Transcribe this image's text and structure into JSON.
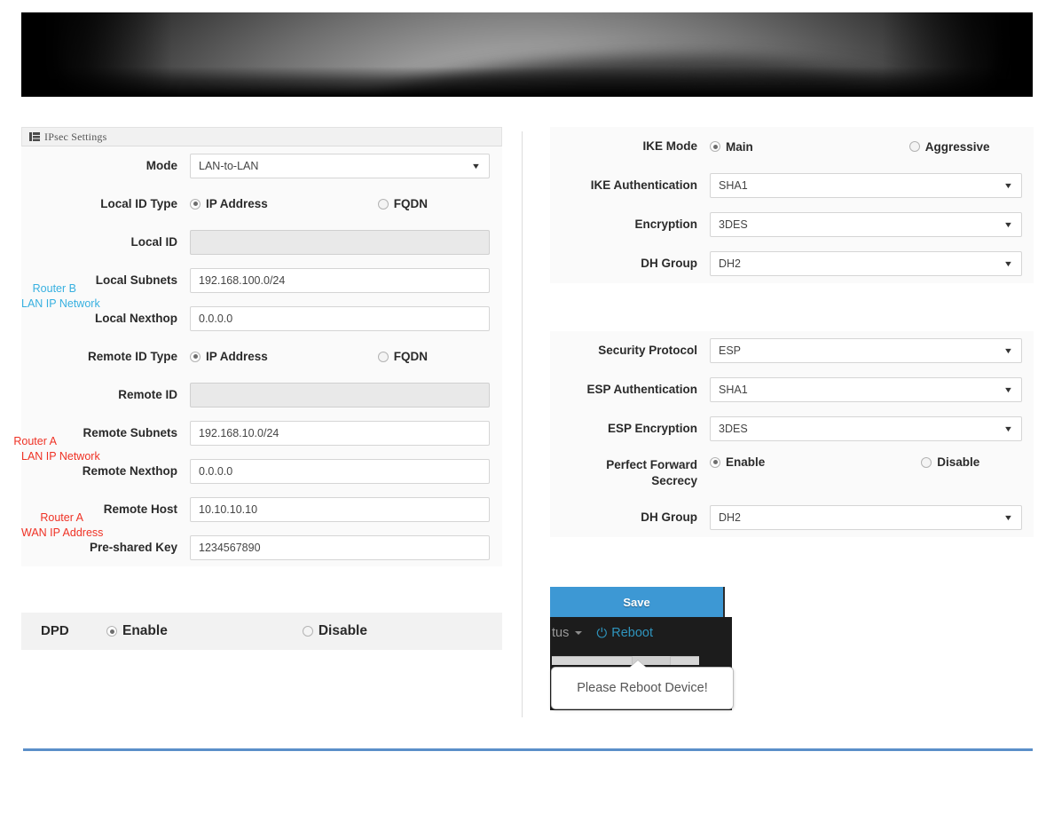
{
  "card": {
    "title": "IPsec Settings",
    "icon": "grid-list-icon"
  },
  "left": {
    "mode": {
      "label": "Mode",
      "value": "LAN-to-LAN"
    },
    "local_id_type": {
      "label": "Local ID Type",
      "options": [
        "IP Address",
        "FQDN"
      ],
      "selected": "IP Address"
    },
    "local_id": {
      "label": "Local ID",
      "value": "",
      "disabled": true
    },
    "local_subnets": {
      "label": "Local Subnets",
      "note_line1": "Router B",
      "note_line2": "LAN IP Network",
      "note_color": "#37b0e0",
      "value": "192.168.100.0/24"
    },
    "local_nexthop": {
      "label": "Local Nexthop",
      "value": "0.0.0.0"
    },
    "remote_id_type": {
      "label": "Remote ID Type",
      "options": [
        "IP Address",
        "FQDN"
      ],
      "selected": "IP Address"
    },
    "remote_id": {
      "label": "Remote ID",
      "value": "",
      "disabled": true
    },
    "remote_subnets": {
      "label": "Remote Subnets",
      "note_line1": "Router A",
      "note_line2": "LAN IP Network",
      "note_color": "#ef3124",
      "value": "192.168.10.0/24"
    },
    "remote_nexthop": {
      "label": "Remote Nexthop",
      "value": "0.0.0.0"
    },
    "remote_host": {
      "label": "Remote Host",
      "note_line1": "Router A",
      "note_line2": "WAN IP Address",
      "note_color": "#ef3124",
      "value": "10.10.10.10"
    },
    "psk": {
      "label": "Pre-shared Key",
      "value": "1234567890"
    },
    "dpd": {
      "label": "DPD",
      "options": [
        "Enable",
        "Disable"
      ],
      "selected": "Enable"
    }
  },
  "right": {
    "ike_mode": {
      "label": "IKE Mode",
      "options": [
        "Main",
        "Aggressive"
      ],
      "selected": "Main"
    },
    "ike_auth": {
      "label": "IKE Authentication",
      "value": "SHA1"
    },
    "encryption": {
      "label": "Encryption",
      "value": "3DES"
    },
    "dh_group_1": {
      "label": "DH Group",
      "value": "DH2"
    },
    "security_protocol": {
      "label": "Security Protocol",
      "value": "ESP"
    },
    "esp_auth": {
      "label": "ESP Authentication",
      "value": "SHA1"
    },
    "esp_encryption": {
      "label": "ESP Encryption",
      "value": "3DES"
    },
    "pfs": {
      "label_line1": "Perfect Forward",
      "label_line2": "Secrecy",
      "options": [
        "Enable",
        "Disable"
      ],
      "selected": "Enable"
    },
    "dh_group_2": {
      "label": "DH Group",
      "value": "DH2"
    }
  },
  "actions": {
    "save_label": "Save",
    "save_color": "#3d98d4"
  },
  "navbar": {
    "status_label": "tus",
    "reboot_label": "Reboot",
    "power_icon": "power-icon",
    "caret_icon": "chevron-down-icon"
  },
  "tooltip": {
    "message": "Please Reboot Device!"
  }
}
